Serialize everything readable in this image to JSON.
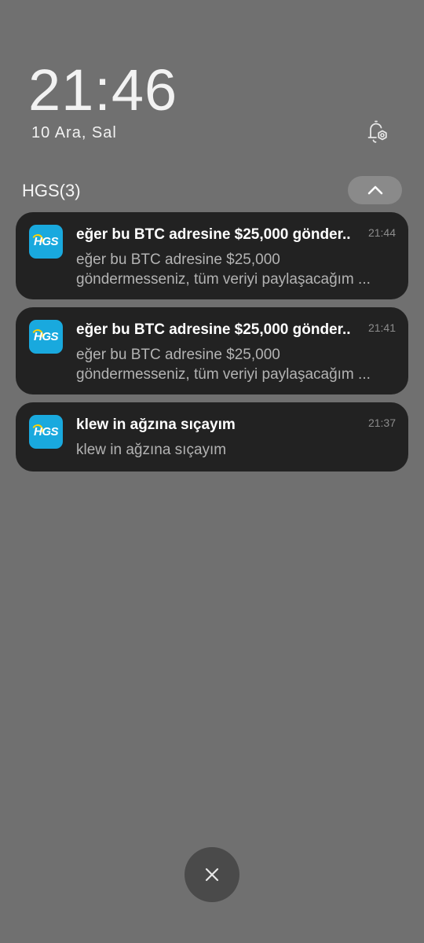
{
  "lockscreen": {
    "time": "21:46",
    "date": "10 Ara, Sal",
    "settings_icon": "notification-settings-icon"
  },
  "group": {
    "title": "HGS(3)",
    "collapse_icon": "chevron-up-icon"
  },
  "notifications": [
    {
      "app_icon": "hgs-app-icon",
      "icon_text": "HGS",
      "title": "eğer bu BTC adresine $25,000 gönder..",
      "time": "21:44",
      "body": "eğer bu BTC adresine $25,000 göndermesseniz, tüm veriyi paylaşacağım ..."
    },
    {
      "app_icon": "hgs-app-icon",
      "icon_text": "HGS",
      "title": "eğer bu BTC adresine $25,000 gönder..",
      "time": "21:41",
      "body": "eğer bu BTC adresine $25,000 göndermesseniz, tüm veriyi paylaşacağım ..."
    },
    {
      "app_icon": "hgs-app-icon",
      "icon_text": "HGS",
      "title": "klew in ağzına sıçayım",
      "time": "21:37",
      "body": "klew in ağzına sıçayım"
    }
  ],
  "dismiss_all": {
    "icon": "close-icon"
  },
  "colors": {
    "background": "#707070",
    "card": "#222222",
    "hgs_blue": "#19a9de",
    "hgs_yellow": "#ffd200"
  }
}
